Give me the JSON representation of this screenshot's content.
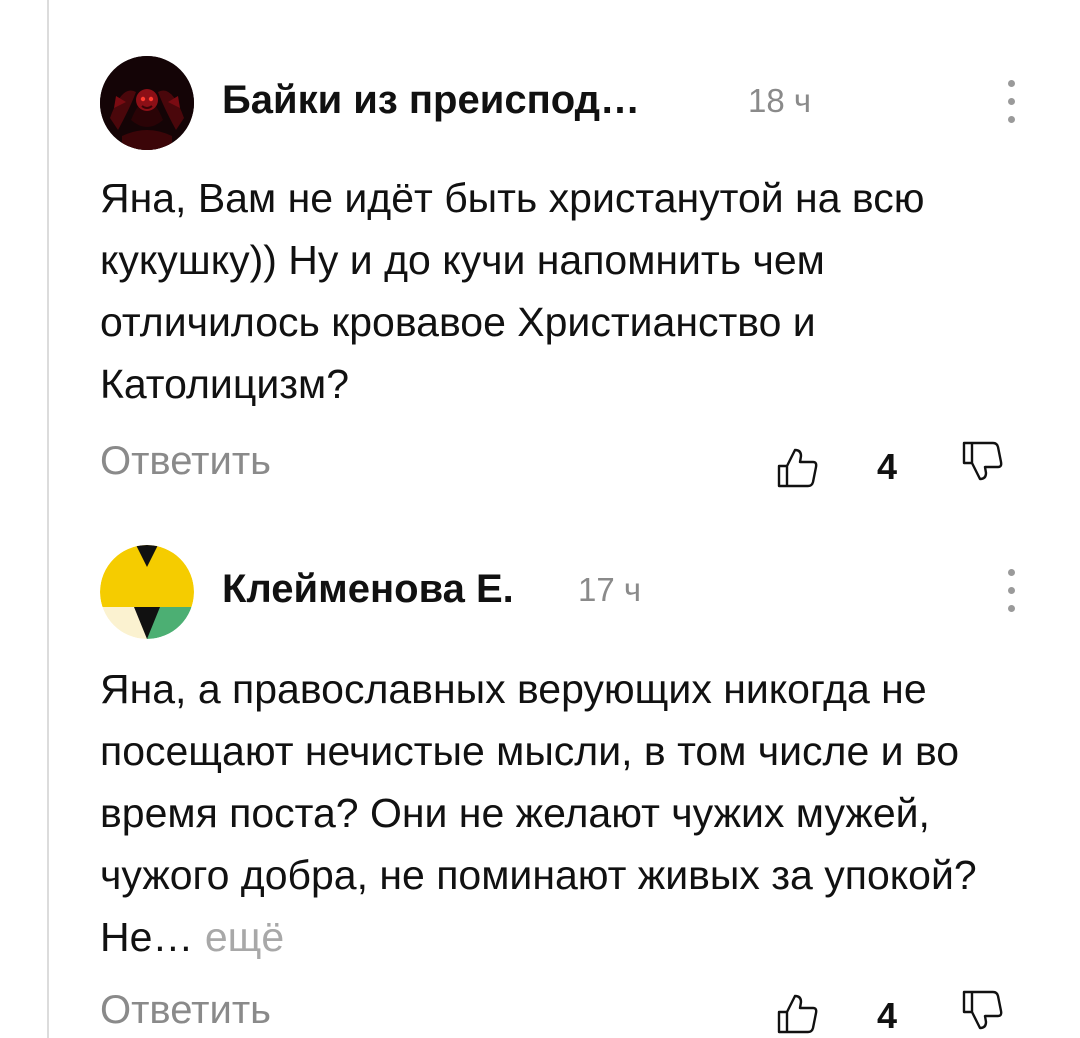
{
  "colors": {
    "text": "#111111",
    "muted": "#8a8a8a",
    "divider": "#dcdcdc"
  },
  "comments": [
    {
      "author": "Байки из преиспод…",
      "time": "18 ч",
      "text": "Яна, Вам не идёт быть христанутой на всю кукушку)) Ну и до кучи напомнить чем отличилось кровавое Христианство и Католицизм?",
      "reply_label": "Ответить",
      "likes": "4",
      "avatar_icon": "dark-skull-avatar-icon",
      "like_icon": "thumbs-up-icon",
      "dislike_icon": "thumbs-down-icon",
      "more_icon": "kebab-menu-icon"
    },
    {
      "author": "Клейменова Е.",
      "time": "17 ч",
      "text": "Яна, а православных верующих никогда не посещают нечистые мысли, в том числе и во время поста? Они не желают чужих мужей, чужого добра, не поминают живых за упокой? Не…",
      "more_label": "ещё",
      "reply_label": "Ответить",
      "likes": "4",
      "avatar_icon": "geometric-avatar-icon",
      "like_icon": "thumbs-up-icon",
      "dislike_icon": "thumbs-down-icon",
      "more_icon": "kebab-menu-icon"
    }
  ]
}
